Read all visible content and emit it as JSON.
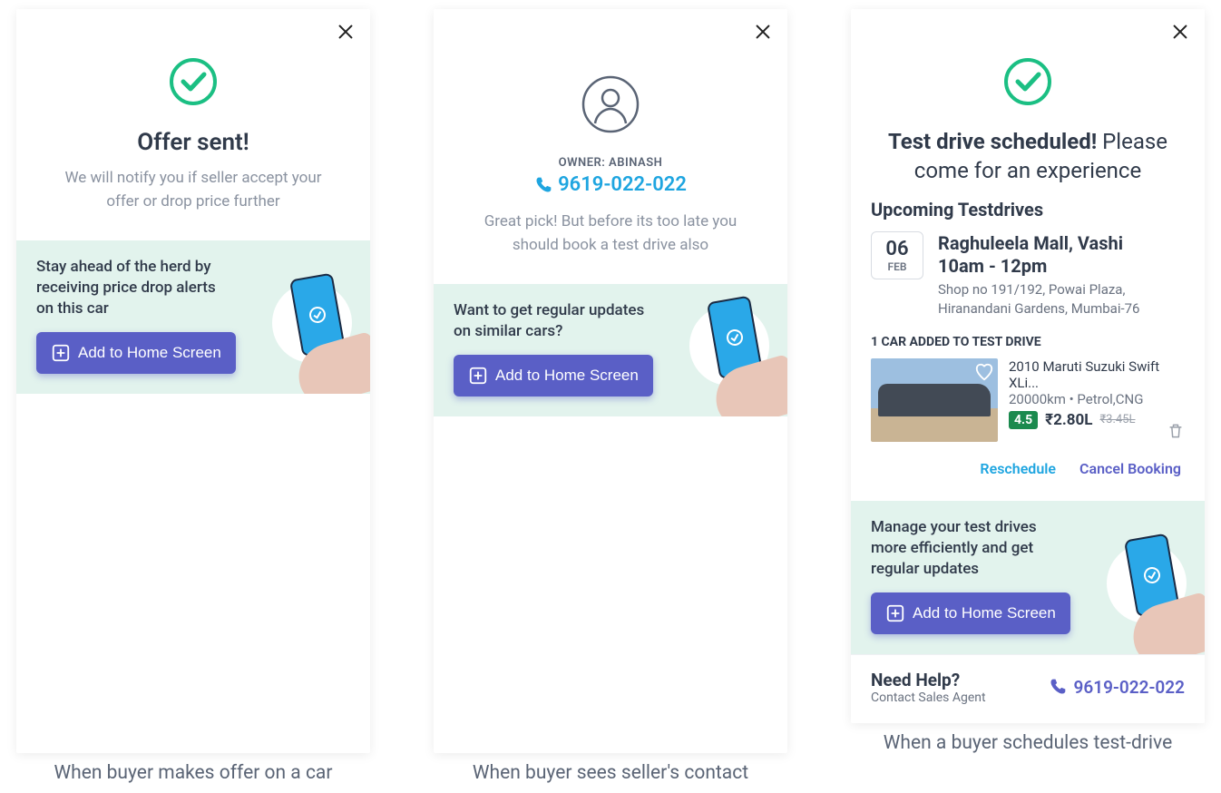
{
  "screen1": {
    "title": "Offer sent!",
    "subtitle": "We will notify you if seller accept your offer or drop price further",
    "banner_text": "Stay ahead of the herd by receiving price drop alerts on this car",
    "add_button": "Add to Home Screen",
    "caption": "When buyer makes offer on a car"
  },
  "screen2": {
    "owner_label": "OWNER: ABINASH",
    "phone": "9619-022-022",
    "subtitle": "Great pick! But before its too late you should book a test drive also",
    "banner_text": "Want to get regular updates on similar cars?",
    "add_button": "Add to Home Screen",
    "caption": "When buyer sees seller's contact"
  },
  "screen3": {
    "title_bold": "Test drive scheduled!",
    "title_rest": " Please come for an experience",
    "upcoming_title": "Upcoming Testdrives",
    "date_day": "06",
    "date_mon": "FEB",
    "location": "Raghuleela Mall, Vashi",
    "time": "10am - 12pm",
    "address": "Shop no 191/192, Powai Plaza, Hiranandani Gardens, Mumbai-76",
    "addcount": "1 CAR ADDED TO TEST DRIVE",
    "car_title": "2010 Maruti Suzuki Swift XLi...",
    "car_sub": "20000km • Petrol,CNG",
    "rating": "4.5",
    "price": "₹2.80L",
    "price_cut": "₹3.45L",
    "reschedule": "Reschedule",
    "cancel": "Cancel Booking",
    "banner_text": "Manage your test drives more efficiently and get regular updates",
    "add_button": "Add to Home Screen",
    "help_title": "Need Help?",
    "help_sub": "Contact Sales Agent",
    "help_phone": "9619-022-022",
    "caption": "When a buyer schedules test-drive"
  }
}
